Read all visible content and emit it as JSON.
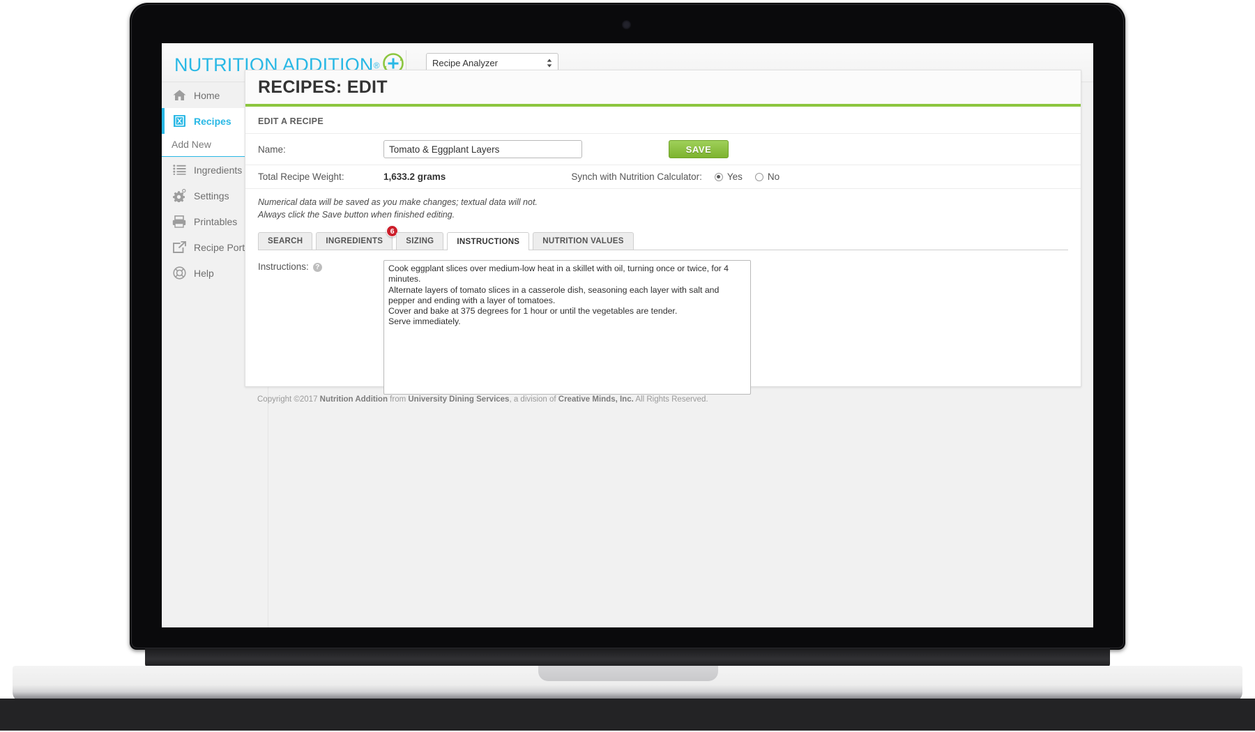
{
  "header": {
    "brand_name": "NUTRITION ADDITION",
    "brand_registered_mark": "®",
    "module_select_value": "Recipe Analyzer",
    "module_select_arrow": "⬍"
  },
  "sidebar": {
    "items": [
      {
        "label": "Home",
        "icon": "home-icon",
        "active": false
      },
      {
        "label": "Recipes",
        "icon": "recipe-book-icon",
        "active": true
      },
      {
        "label": "Ingredients",
        "icon": "list-icon",
        "active": false
      },
      {
        "label": "Settings",
        "icon": "gear-icon",
        "active": false
      },
      {
        "label": "Printables",
        "icon": "printer-icon",
        "active": false
      },
      {
        "label": "Recipe Porter",
        "icon": "export-icon",
        "active": false
      },
      {
        "label": "Help",
        "icon": "life-preserver-icon",
        "active": false
      }
    ],
    "sub_item_add_new": "Add New"
  },
  "main": {
    "page_title": "RECIPES: EDIT",
    "section_heading": "EDIT A RECIPE",
    "name_label": "Name:",
    "name_value": "Tomato & Eggplant Layers",
    "save_label": "SAVE",
    "total_weight_label": "Total Recipe Weight:",
    "total_weight_value": "1,633.2 grams",
    "synch_label": "Synch with Nutrition Calculator:",
    "synch_yes_label": "Yes",
    "synch_no_label": "No",
    "synch_selected": "Yes",
    "editing_note_line1": "Numerical data will be saved as you make changes; textual data will not.",
    "editing_note_line2": "Always click the Save button when finished editing.",
    "tabs": [
      {
        "label": "SEARCH",
        "active": false,
        "badge": null
      },
      {
        "label": "INGREDIENTS",
        "active": false,
        "badge": "6"
      },
      {
        "label": "SIZING",
        "active": false,
        "badge": null
      },
      {
        "label": "INSTRUCTIONS",
        "active": true,
        "badge": null
      },
      {
        "label": "NUTRITION VALUES",
        "active": false,
        "badge": null
      }
    ],
    "instructions_label": "Instructions:",
    "instructions_help_glyph": "?",
    "instructions_value": "Cook eggplant slices over medium-low heat in a skillet with oil, turning once or twice, for 4 minutes.\nAlternate layers of tomato slices in a casserole dish, seasoning each layer with salt and pepper and ending with a layer of tomatoes.\nCover and bake at 375 degrees for 1 hour or until the vegetables are tender.\nServe immediately."
  },
  "footer": {
    "copyright_prefix": "Copyright ©2017 ",
    "brand": "Nutrition Addition",
    "from_text": " from ",
    "org": "University Dining Services",
    "division_text": ", a division of ",
    "parent": "Creative Minds, Inc.",
    "rights_text": " All Rights Reserved."
  },
  "colors": {
    "brand_cyan": "#29b8e5",
    "accent_green": "#8cc63f",
    "save_green": "#7db32f",
    "badge_red": "#cc1f2b"
  }
}
